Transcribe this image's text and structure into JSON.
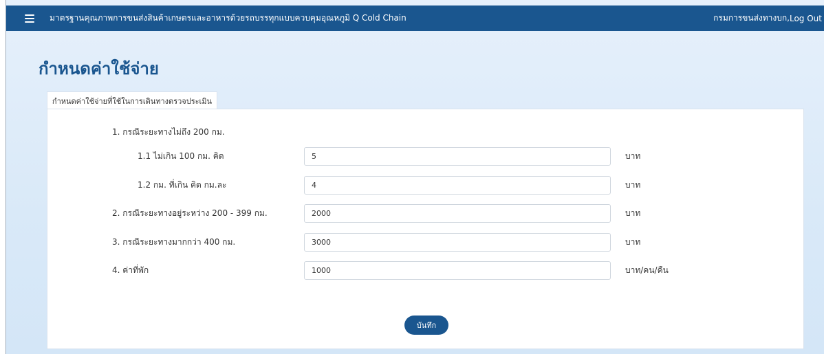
{
  "header": {
    "menu_icon": "hamburger-menu-icon",
    "title": "มาตรฐานคุณภาพการขนส่งสินค้าเกษตรและอาหารด้วยรถบรรทุกแบบควบคุมอุณหภูมิ Q Cold Chain",
    "user_name": "กรมการขนส่งทางบก, ",
    "logout_label": "Log Out"
  },
  "page": {
    "title": "กำหนดค่าใช้จ่าย",
    "tab_label": "กำหนดค่าใช้จ่ายที่ใช้ในการเดินทางตรวจประเมิน"
  },
  "form": {
    "heading_1": "1. กรณีระยะทางไม่ถึง 200 กม.",
    "rows": [
      {
        "label": "1.1   ไม่เกิน 100 กม. คิด",
        "value": "5",
        "unit": "บาท"
      },
      {
        "label": "1.2    กม. ที่เกิน คิด กม.ละ",
        "value": "4",
        "unit": "บาท"
      },
      {
        "label": "2. กรณีระยะทางอยู่ระหว่าง 200 - 399 กม.",
        "value": "2000",
        "unit": "บาท"
      },
      {
        "label": "3. กรณีระยะทางมากกว่า 400 กม.",
        "value": "3000",
        "unit": "บาท"
      },
      {
        "label": "4. ค่าที่พัก",
        "value": "1000",
        "unit": "บาท/คน/คืน"
      }
    ],
    "save_label": "บันทึก"
  },
  "colors": {
    "primary": "#1a568f",
    "background": "#dbe9f8"
  }
}
